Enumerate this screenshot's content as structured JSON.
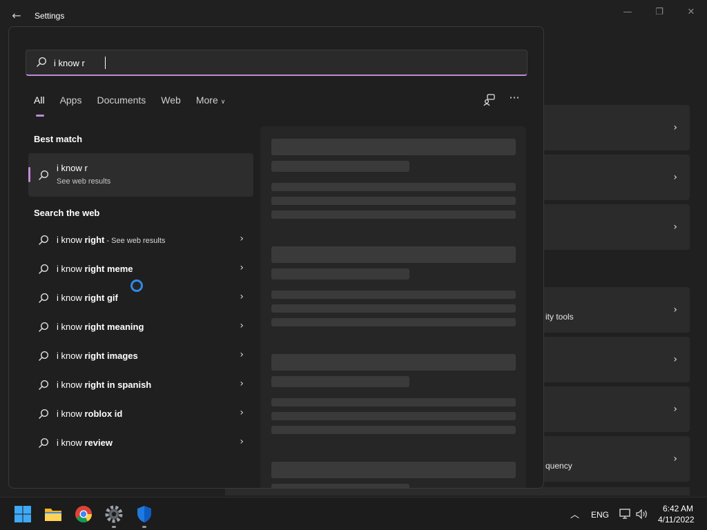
{
  "window": {
    "back_glyph": "←",
    "title": "Settings",
    "minimize_glyph": "—",
    "maximize_glyph": "❐",
    "close_glyph": "✕"
  },
  "background_cards": [
    {
      "text": ""
    },
    {
      "text": ""
    },
    {
      "text": ""
    },
    {
      "text": "ity tools"
    },
    {
      "text": ""
    },
    {
      "text": ""
    },
    {
      "text": "quency"
    }
  ],
  "search": {
    "query": "i know r",
    "placeholder": ""
  },
  "tabs": [
    {
      "label": "All",
      "active": true
    },
    {
      "label": "Apps"
    },
    {
      "label": "Documents"
    },
    {
      "label": "Web"
    },
    {
      "label": "More"
    }
  ],
  "tools": {
    "more_glyph": "···"
  },
  "best_match": {
    "heading": "Best match",
    "title": "i know r",
    "subtitle": "See web results"
  },
  "web": {
    "heading": "Search the web",
    "items": [
      {
        "prefix": "i know ",
        "bold": "right",
        "suffix": " - See web results"
      },
      {
        "prefix": "i know ",
        "bold": "right meme",
        "suffix": ""
      },
      {
        "prefix": "i know ",
        "bold": "right gif",
        "suffix": ""
      },
      {
        "prefix": "i know ",
        "bold": "right meaning",
        "suffix": ""
      },
      {
        "prefix": "i know ",
        "bold": "right images",
        "suffix": ""
      },
      {
        "prefix": "i know ",
        "bold": "right in spanish",
        "suffix": ""
      },
      {
        "prefix": "i know ",
        "bold": "roblox id",
        "suffix": ""
      },
      {
        "prefix": "i know ",
        "bold": "review",
        "suffix": ""
      }
    ]
  },
  "tray": {
    "chevron_glyph": "︿",
    "language": "ENG",
    "time": "6:42 AM",
    "date": "4/11/2022"
  },
  "colors": {
    "accent": "#c18bd4",
    "cursor_ring": "#2f8ae6",
    "background": "#202020"
  }
}
